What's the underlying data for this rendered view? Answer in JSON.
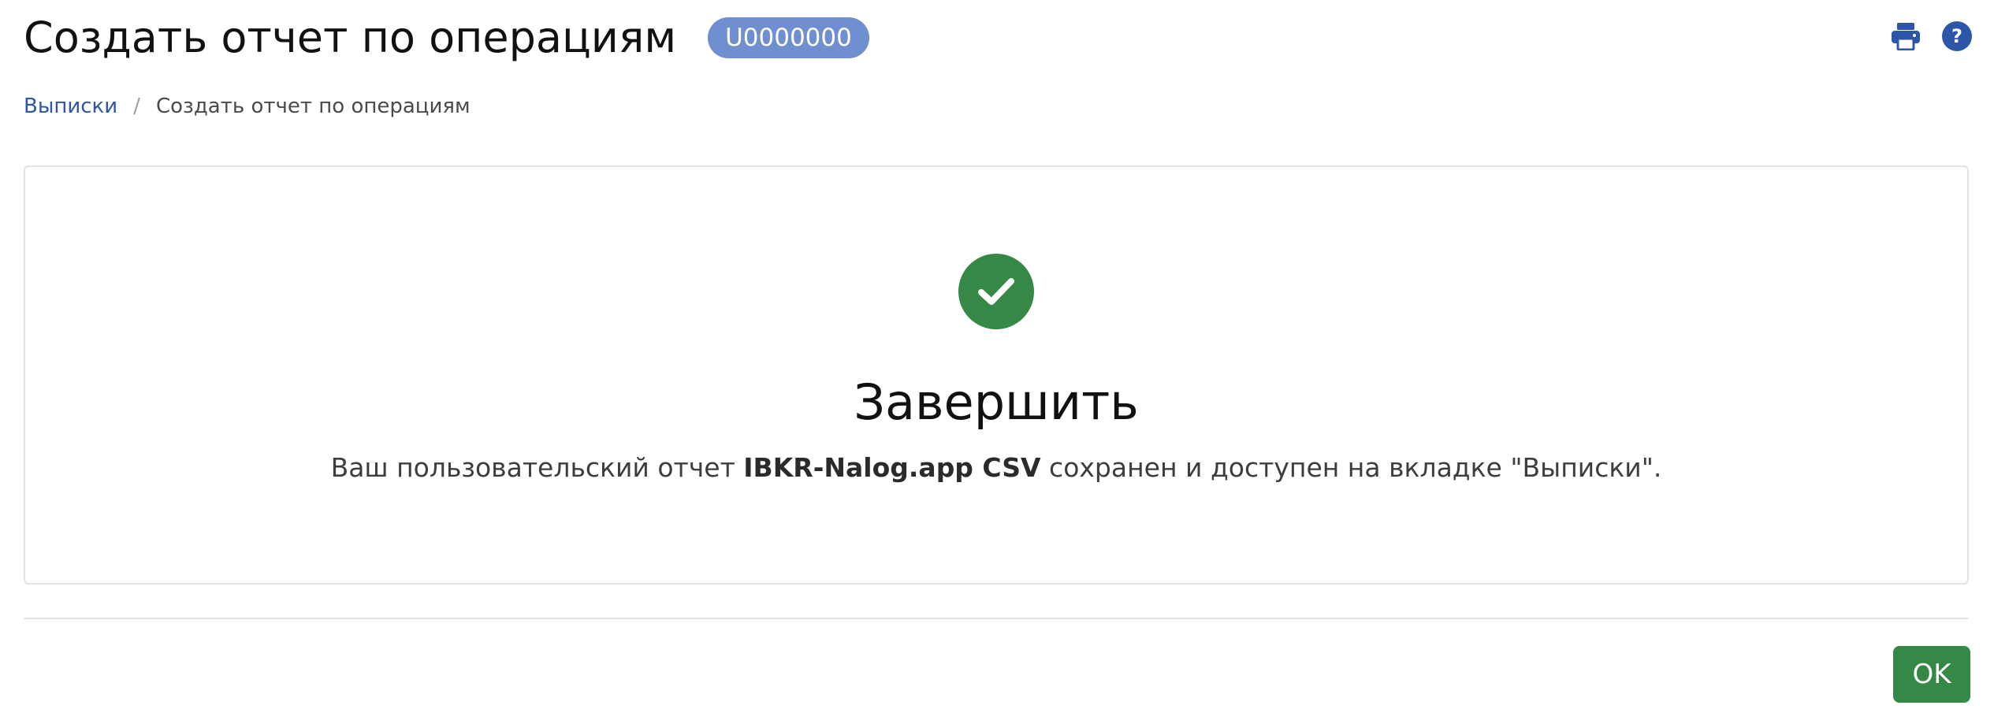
{
  "header": {
    "title": "Создать отчет по операциям",
    "account_badge": "U0000000",
    "print_icon": "printer-icon",
    "help_icon": "help-icon",
    "help_symbol": "?"
  },
  "breadcrumb": {
    "items": [
      {
        "label": "Выписки",
        "link": true
      },
      {
        "label": "Создать отчет по операциям",
        "link": false
      }
    ],
    "separator": "/"
  },
  "result": {
    "icon": "checkmark-icon",
    "title": "Завершить",
    "message_prefix": "Ваш пользовательский отчет ",
    "report_name": "IBKR-Nalog.app CSV",
    "message_suffix": " сохранен и доступен на вкладке \"Выписки\"."
  },
  "footer": {
    "ok_label": "OK"
  },
  "colors": {
    "brand_blue": "#2d55a8",
    "badge_blue": "#6f8fd0",
    "success_green": "#368846",
    "border_gray": "#e1e3e6"
  }
}
